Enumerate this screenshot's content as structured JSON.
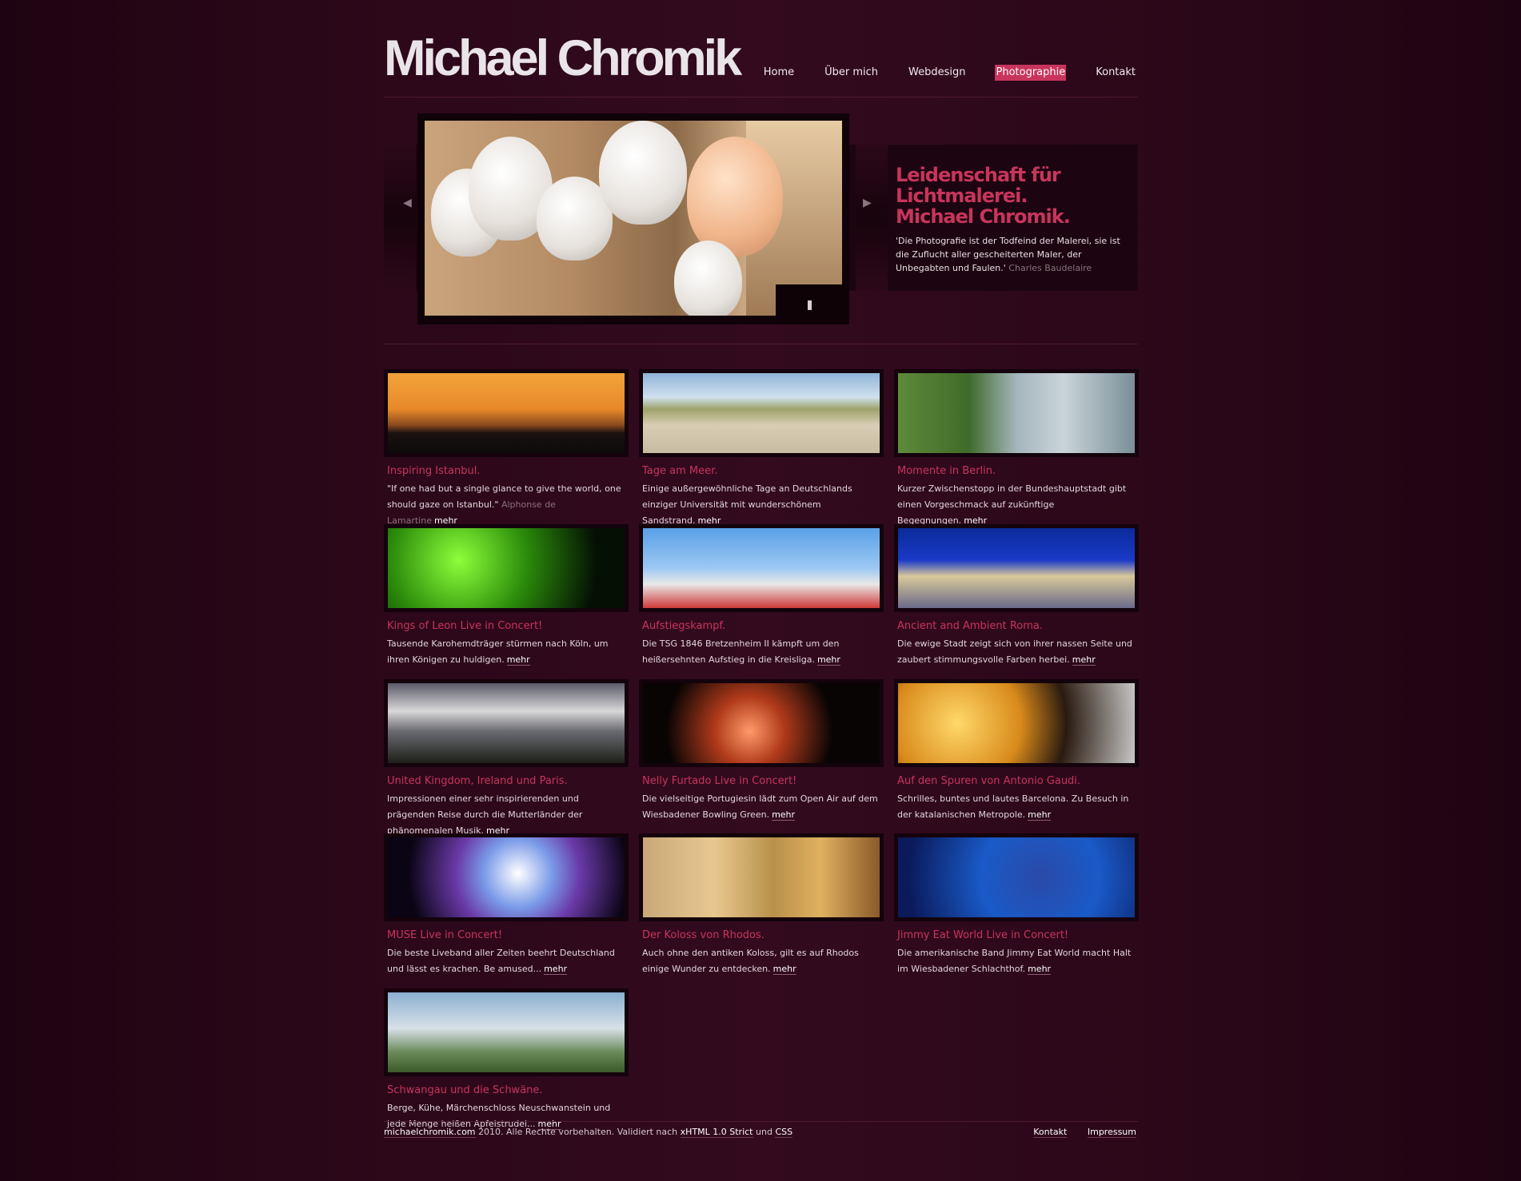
{
  "site": {
    "logo": "Michael Chromik"
  },
  "nav": [
    {
      "label": "Home",
      "active": false
    },
    {
      "label": "Über mich",
      "active": false
    },
    {
      "label": "Webdesign",
      "active": false
    },
    {
      "label": "Photographie",
      "active": true
    },
    {
      "label": "Kontakt",
      "active": false
    }
  ],
  "hero": {
    "title": "Leidenschaft für\nLichtmalerei.\nMichael Chromik.",
    "quote": "'Die Photografie ist der Todfeind der Malerei, sie ist die Zuflucht aller gescheiterten Maler, der Unbegabten und Faulen.'",
    "quote_source": "Charles Baudelaire",
    "prev_icon": "arrow-left-icon",
    "next_icon": "arrow-right-icon",
    "pause_icon": "pause-icon"
  },
  "gallery": [
    {
      "title": "Inspiring Istanbul.",
      "text": "\"If one had but a single glance to give the world, one should gaze on Istanbul.\"",
      "source": "Alphonse de Lamartine",
      "more": "mehr"
    },
    {
      "title": "Tage am Meer.",
      "text": "Einige außergewöhnliche Tage an Deutschlands einziger Universität mit wunderschönem Sandstrand.",
      "source": "",
      "more": "mehr"
    },
    {
      "title": "Momente in Berlin.",
      "text": "Kurzer Zwischenstopp in der Bundeshauptstadt gibt einen Vorgeschmack auf zukünftige Begegnungen.",
      "source": "",
      "more": "mehr"
    },
    {
      "title": "Kings of Leon Live in Concert!",
      "text": "Tausende Karohemdträger stürmen nach Köln, um ihren Königen zu huldigen.",
      "source": "",
      "more": "mehr"
    },
    {
      "title": "Aufstiegskampf.",
      "text": "Die TSG 1846 Bretzenheim II kämpft um den heißersehnten Aufstieg in die Kreisliga.",
      "source": "",
      "more": "mehr"
    },
    {
      "title": "Ancient and Ambient Roma.",
      "text": "Die ewige Stadt zeigt sich von ihrer nassen Seite und zaubert stimmungsvolle Farben herbei.",
      "source": "",
      "more": "mehr"
    },
    {
      "title": "United Kingdom, Ireland und Paris.",
      "text": "Impressionen einer sehr inspirierenden und prägenden Reise durch die Mutterländer der phänomenalen Musik.",
      "source": "",
      "more": "mehr"
    },
    {
      "title": "Nelly Furtado Live in Concert!",
      "text": "Die vielseitige Portugiesin lädt zum Open Air auf dem Wiesbadener Bowling Green.",
      "source": "",
      "more": "mehr"
    },
    {
      "title": "Auf den Spuren von Antonio Gaudi.",
      "text": "Schrilles, buntes und lautes Barcelona. Zu Besuch in der katalanischen Metropole.",
      "source": "",
      "more": "mehr"
    },
    {
      "title": "MUSE Live in Concert!",
      "text": "Die beste Liveband aller Zeiten beehrt Deutschland und lässt es krachen. Be amused...",
      "source": "",
      "more": "mehr"
    },
    {
      "title": "Der Koloss von Rhodos.",
      "text": "Auch ohne den antiken Koloss, gilt es auf Rhodos einige Wunder zu entdecken.",
      "source": "",
      "more": "mehr"
    },
    {
      "title": "Jimmy Eat World Live in Concert!",
      "text": "Die amerikanische Band Jimmy Eat World macht Halt im Wiesbadener Schlachthof.",
      "source": "",
      "more": "mehr"
    },
    {
      "title": "Schwangau und die Schwäne.",
      "text": "Berge, Kühe, Märchenschloss Neuschwanstein und jede Menge heißen Apfelstrudel...",
      "source": "",
      "more": "mehr"
    }
  ],
  "footer": {
    "domain": "michaelchromik.com",
    "copyright": "2010. Alle Rechte vorbehalten. Validiert nach",
    "xhtml": "xHTML 1.0 Strict",
    "und": "und",
    "css": "CSS",
    "links": [
      "Kontakt",
      "Impressum"
    ]
  },
  "colors": {
    "accent": "#c8355c",
    "background": "#2a0718"
  }
}
